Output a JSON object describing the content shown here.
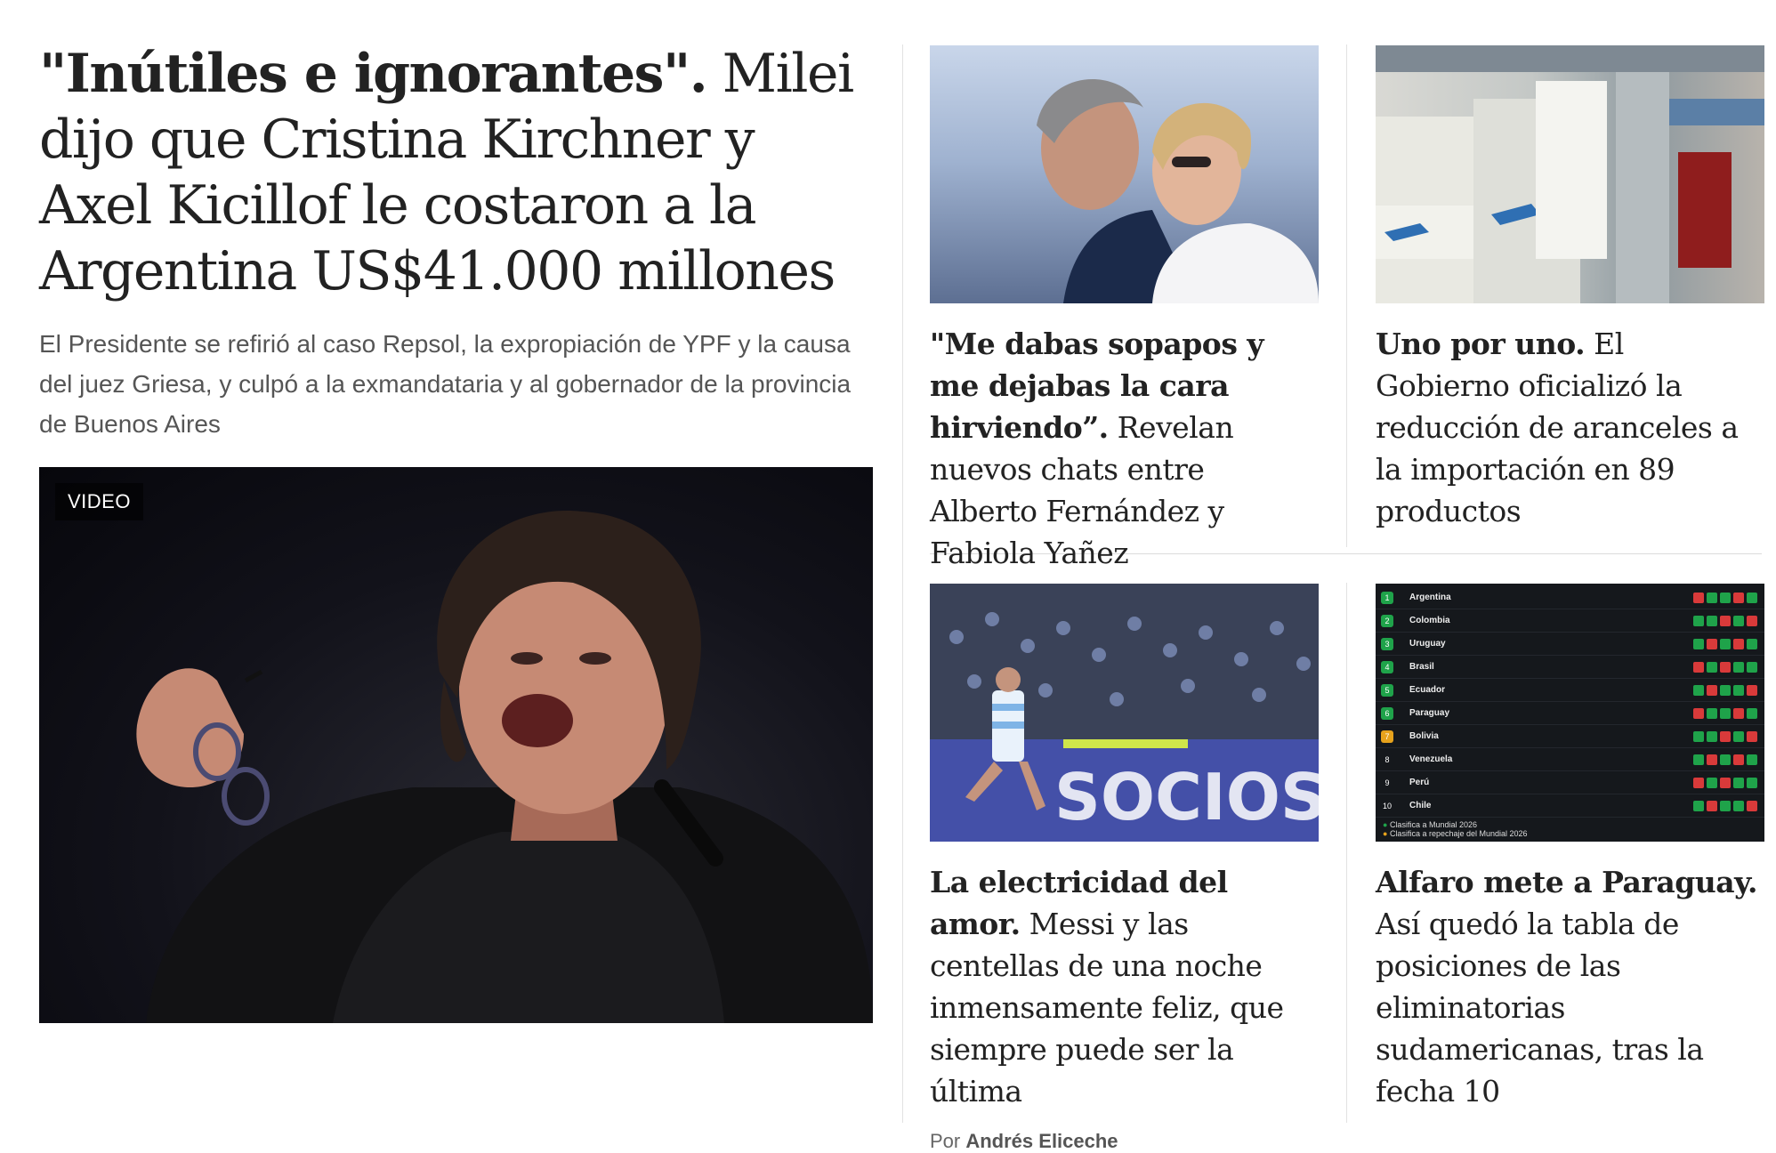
{
  "main": {
    "title_kicker": "\"Inútiles e ignorantes\".",
    "title_rest": " Milei dijo que Cristina Kirchner y Axel Kicillof le costaron a la Argentina US$41.000 millones",
    "summary": "El Presidente se refirió al caso Repsol, la expropiación de YPF y la causa del juez Griesa, y culpó a la exmandataria y al gobernador de la provincia de Buenos Aires",
    "media_badge": "VIDEO"
  },
  "cards": [
    {
      "kicker": "\"Me dabas sopapos y me dejabas la cara hirviendo”.",
      "rest": " Revelan nuevos chats entre Alberto Fernández y Fabiola Yañez"
    },
    {
      "kicker": "Uno por uno.",
      "rest": " El Gobierno oficializó la reducción de aranceles a la importación en 89 productos"
    },
    {
      "kicker": "La electricidad del amor.",
      "rest": " Messi y las centellas de una noche inmensamente feliz, que siempre puede ser la última",
      "byline_prefix": "Por ",
      "byline_author": "Andrés Eliceche"
    },
    {
      "kicker": "Alfaro mete a Paraguay.",
      "rest": " Así quedó la tabla de posiciones de las eliminatorias sudamericanas, tras la fecha 10"
    }
  ],
  "photo_texts": {
    "banner": "SOCIOS"
  },
  "standings": {
    "rows": [
      {
        "rank": "1",
        "team": "Argentina",
        "color": "#1fa34a"
      },
      {
        "rank": "2",
        "team": "Colombia",
        "color": "#1fa34a"
      },
      {
        "rank": "3",
        "team": "Uruguay",
        "color": "#1fa34a"
      },
      {
        "rank": "4",
        "team": "Brasil",
        "color": "#1fa34a"
      },
      {
        "rank": "5",
        "team": "Ecuador",
        "color": "#1fa34a"
      },
      {
        "rank": "6",
        "team": "Paraguay",
        "color": "#1fa34a"
      },
      {
        "rank": "7",
        "team": "Bolivia",
        "color": "#e6a21c"
      },
      {
        "rank": "8",
        "team": "Venezuela",
        "color": "#15181c"
      },
      {
        "rank": "9",
        "team": "Perú",
        "color": "#15181c"
      },
      {
        "rank": "10",
        "team": "Chile",
        "color": "#15181c"
      }
    ],
    "legend_1": "Clasifica a Mundial 2026",
    "legend_2": "Clasifica a repechaje del Mundial 2026"
  }
}
